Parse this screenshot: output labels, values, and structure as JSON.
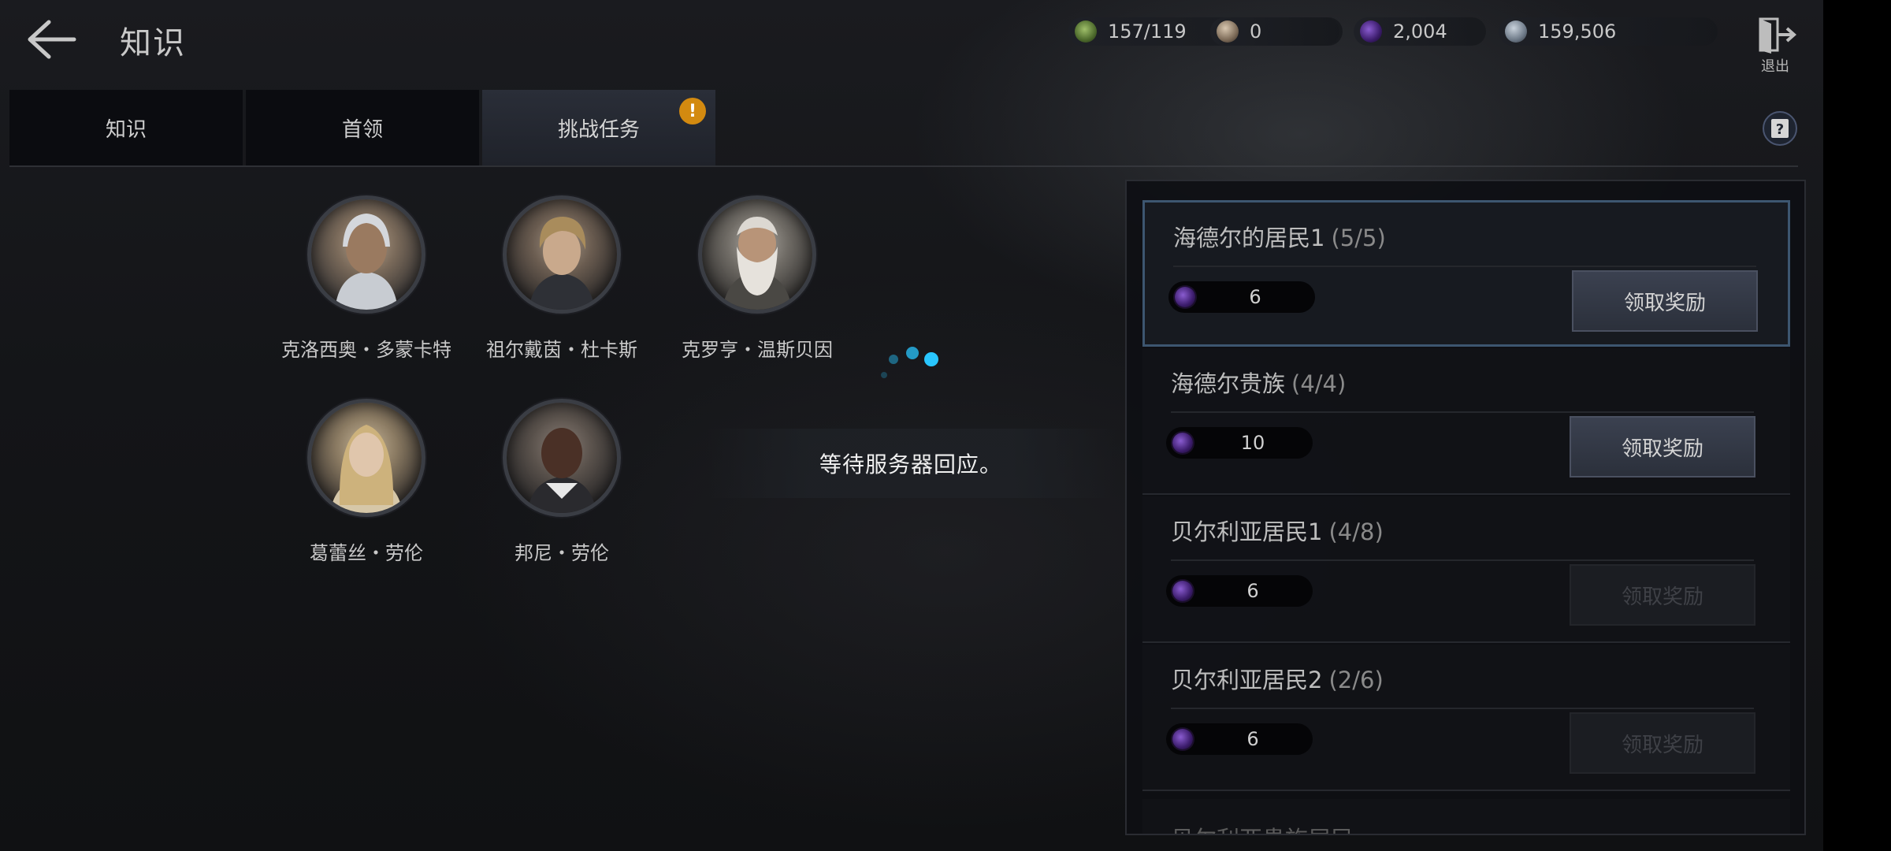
{
  "header": {
    "title": "知识",
    "exit_label": "退出"
  },
  "currencies": [
    {
      "icon": "green-gem-icon",
      "value": "157/119"
    },
    {
      "icon": "stone-orb-icon",
      "value": "0"
    },
    {
      "icon": "purple-orb-icon",
      "value": "2,004"
    },
    {
      "icon": "silver-coin-icon",
      "value": "159,506"
    }
  ],
  "tabs": [
    {
      "label": "知识"
    },
    {
      "label": "首领"
    },
    {
      "label": "挑战任务"
    }
  ],
  "tab_badge": "!",
  "characters": [
    {
      "name": "克洛西奥・多蒙卡特"
    },
    {
      "name": "祖尔戴茵・杜卡斯"
    },
    {
      "name": "克罗亨・温斯贝因"
    },
    {
      "name": "葛蕾丝・劳伦"
    },
    {
      "name": "邦尼・劳伦"
    }
  ],
  "loading": {
    "message": "等待服务器回应。"
  },
  "quests": [
    {
      "title": "海德尔的居民1",
      "progress": "(5/5)",
      "reward": "6",
      "button": "领取奖励"
    },
    {
      "title": "海德尔贵族",
      "progress": "(4/4)",
      "reward": "10",
      "button": "领取奖励"
    },
    {
      "title": "贝尔利亚居民1",
      "progress": "(4/8)",
      "reward": "6",
      "button": "领取奖励"
    },
    {
      "title": "贝尔利亚居民2",
      "progress": "(2/6)",
      "reward": "6",
      "button": "领取奖励"
    }
  ],
  "quest_partial_text": "贝尔利亚贵族居民",
  "colors": {
    "accent_orange": "#d38a10",
    "selected_border": "#3d5670",
    "loading_blue": "#29c6ff"
  }
}
